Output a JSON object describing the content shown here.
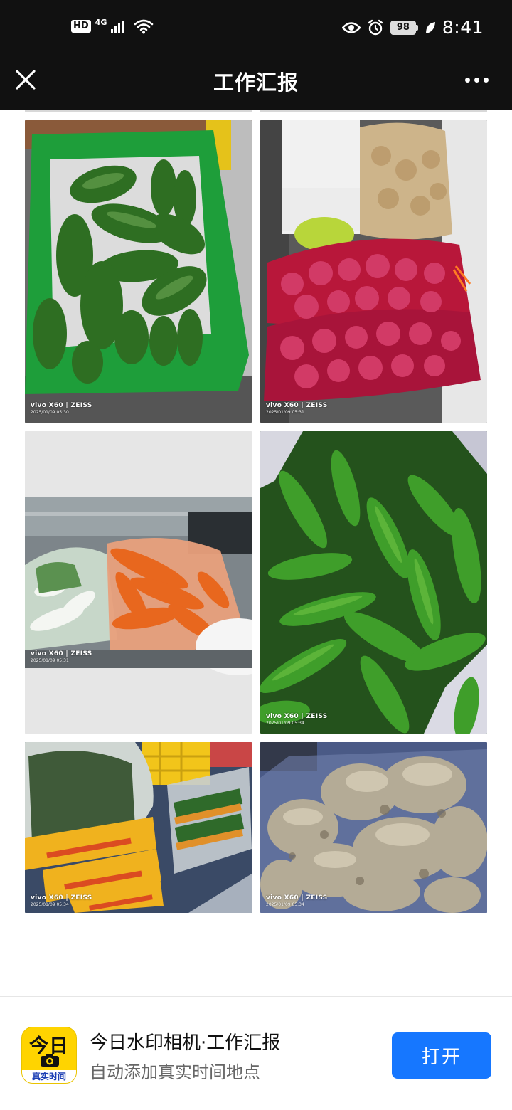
{
  "status_bar": {
    "hd": "HD",
    "network": "4G",
    "battery": "98",
    "time": "8:41"
  },
  "header": {
    "title": "工作汇报",
    "close_icon": "close-icon",
    "more_icon": "more-icon"
  },
  "photos": [
    {
      "subject": "winter-melons-in-green-crate",
      "watermark": "vivo X60 | ZEISS",
      "date": "2025/01/09 05:30"
    },
    {
      "subject": "red-onions-and-potatoes-in-mesh-bags",
      "watermark": "vivo X60 | ZEISS",
      "date": "2025/01/09 05:31"
    },
    {
      "subject": "radishes-and-carrots-in-plastic-bags",
      "watermark": "vivo X60 | ZEISS",
      "date": "2025/01/09 05:31"
    },
    {
      "subject": "green-peppers",
      "watermark": "vivo X60 | ZEISS",
      "date": "2025/01/09 05:34"
    },
    {
      "subject": "bagged-vegetables-and-crates",
      "watermark": "vivo X60 | ZEISS",
      "date": "2025/01/09 05:34"
    },
    {
      "subject": "ginger-roots",
      "watermark": "vivo X60 | ZEISS",
      "date": "2025/01/09 05:34"
    }
  ],
  "banner": {
    "icon_top": "今日",
    "icon_bottom": "真实时间",
    "app_name": "今日水印相机·工作汇报",
    "app_desc": "自动添加真实时间地点",
    "open_label": "打开",
    "accent": "#1677ff",
    "icon_bg": "#ffd400"
  }
}
